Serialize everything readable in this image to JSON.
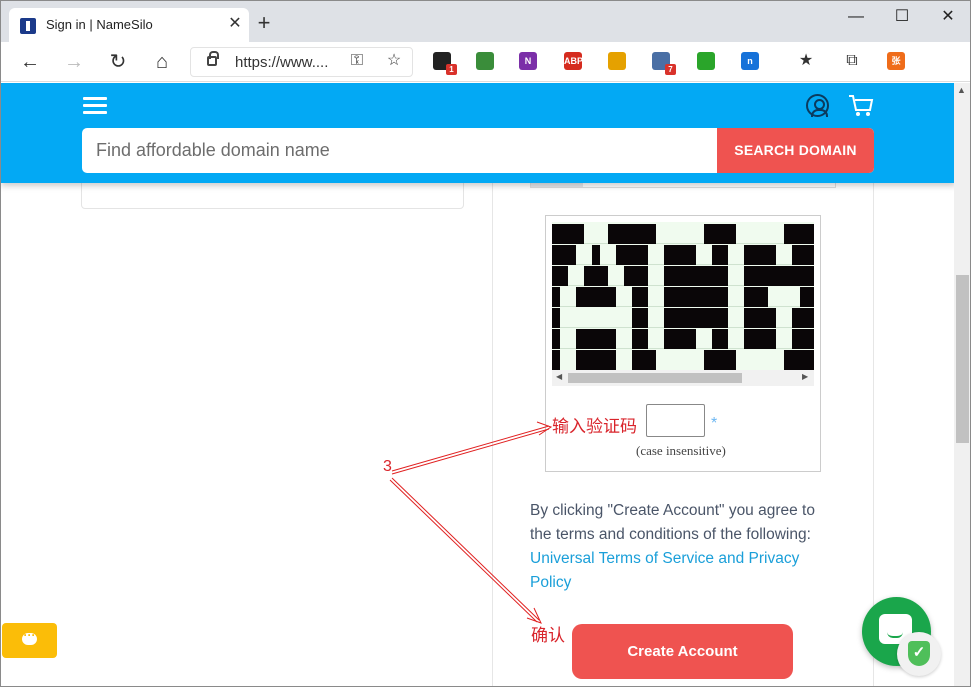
{
  "browser": {
    "tab_title": "Sign in | NameSilo",
    "tab_close": "✕",
    "new_tab": "+",
    "window_minimize": "—",
    "window_maximize": "☐",
    "window_close": "✕",
    "url": "https://www...."
  },
  "extensions": [
    {
      "icon": "extension-cube-icon",
      "color": "#222222",
      "badge": "1"
    },
    {
      "icon": "extension-globe-icon",
      "color": "#3a8d3a",
      "badge": ""
    },
    {
      "icon": "onenote-icon",
      "color": "#7b2fa8",
      "label": "N",
      "badge": ""
    },
    {
      "icon": "adblock-plus-icon",
      "color": "#d52b1e",
      "label": "ABP",
      "badge": ""
    },
    {
      "icon": "extension-cat-icon",
      "color": "#e5a100",
      "badge": ""
    },
    {
      "icon": "extension-puzzle-icon",
      "color": "#4a6fa5",
      "badge": "7"
    },
    {
      "icon": "tv-icon",
      "color": "#2aa52a",
      "badge": ""
    },
    {
      "icon": "extension-n-icon",
      "color": "#1672d9",
      "label": "n",
      "badge": ""
    },
    {
      "icon": "extension-zhang-icon",
      "color": "#ef6c1a",
      "label": "张",
      "badge": ""
    }
  ],
  "header": {
    "search_placeholder": "Find affordable domain name",
    "search_button": "SEARCH DOMAIN",
    "bg_color": "#03a9f4",
    "accent_color": "#ef5350"
  },
  "captcha": {
    "annotation_label": "输入验证码",
    "required_mark": "*",
    "case_note": "(case insensitive)"
  },
  "terms": {
    "text": "By clicking \"Create Account\" you agree to the terms and conditions of the following:",
    "link": "Universal Terms of Service and Privacy Policy"
  },
  "confirm_annotation": "确认",
  "create_account_button": "Create Account",
  "annotation_number": "3"
}
